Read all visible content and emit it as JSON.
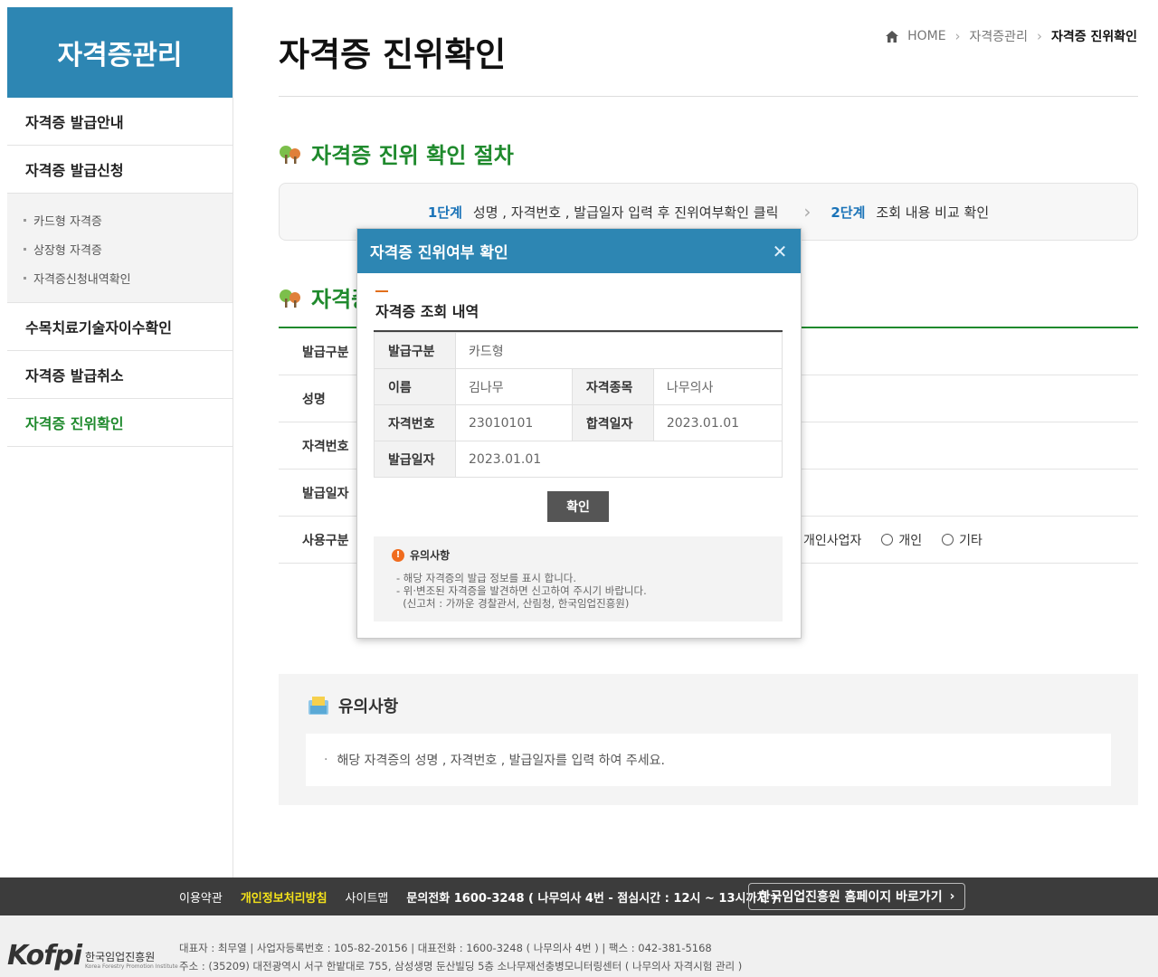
{
  "sidebar": {
    "title": "자격증관리",
    "items": [
      {
        "label": "자격증 발급안내"
      },
      {
        "label": "자격증 발급신청"
      }
    ],
    "sub_items": [
      {
        "label": "카드형 자격증"
      },
      {
        "label": "상장형 자격증"
      },
      {
        "label": "자격증신청내역확인"
      }
    ],
    "items_after": [
      {
        "label": "수목치료기술자이수확인"
      },
      {
        "label": "자격증 발급취소"
      },
      {
        "label": "자격증 진위확인"
      }
    ]
  },
  "header": {
    "title": "자격증 진위확인",
    "breadcrumb": [
      "HOME",
      "자격증관리",
      "자격증 진위확인"
    ]
  },
  "procedure": {
    "title": "자격증 진위 확인 절차",
    "step1_num": "1단계",
    "step1_text": "성명 , 자격번호 , 발급일자 입력 후 진위여부확인 클릭",
    "step2_num": "2단계",
    "step2_text": "조회 내용 비교 확인"
  },
  "form": {
    "title": "자격증",
    "rows": [
      "발급구분",
      "성명",
      "자격번호",
      "발급일자",
      "사용구분"
    ],
    "radio_options": [
      "개인사업자",
      "개인",
      "기타"
    ]
  },
  "notice": {
    "title": "유의사항",
    "text": "해당 자격증의 성명 , 자격번호 , 발급일자를 입력 하여 주세요."
  },
  "modal": {
    "title": "자격증 진위여부 확인",
    "subtitle": "자격증 조회 내역",
    "fields": {
      "type_label": "발급구분",
      "type_value": "카드형",
      "name_label": "이름",
      "name_value": "김나무",
      "cat_label": "자격종목",
      "cat_value": "나무의사",
      "num_label": "자격번호",
      "num_value": "23010101",
      "pass_label": "합격일자",
      "pass_value": "2023.01.01",
      "issue_label": "발급일자",
      "issue_value": "2023.01.01"
    },
    "confirm_label": "확인",
    "notice_title": "유의사항",
    "notice_lines": [
      "- 해당 자격증의 발급 정보를 표시 합니다.",
      "- 위·변조된 자격증을 발견하면 신고하여 주시기 바랍니다.",
      "  (신고처 : 가까운 경찰관서, 산림청, 한국임업진흥원)"
    ]
  },
  "footer": {
    "links": [
      "이용약관",
      "개인정보처리방침",
      "사이트맵"
    ],
    "phone": "문의전화 1600-3248 ( 나무의사 4번 - 점심시간 : 12시 ~ 13시까지 )",
    "home_link": "한국임업진흥원 홈페이지 바로가기",
    "info_line1": "대표자 : 최무열 | 사업자등록번호 : 105-82-20156 | 대표전화 : 1600-3248 ( 나무의사 4번 ) | 팩스 : 042-381-5168",
    "info_line2": "주소 : (35209) 대전광역시 서구 한밭대로 755, 삼성생명 둔산빌딩 5층 소나무재선충병모니터링센터 ( 나무의사 자격시험 관리 )",
    "logo_mark": "Kofpi",
    "logo_name": "한국임업진흥원",
    "logo_sub": "Korea Forestry Promotion Institute"
  },
  "colors": {
    "brand_blue": "#2d86b3",
    "brand_green": "#1f8a2d",
    "step_blue": "#1a73b8",
    "footer_highlight": "#f3e11a"
  }
}
